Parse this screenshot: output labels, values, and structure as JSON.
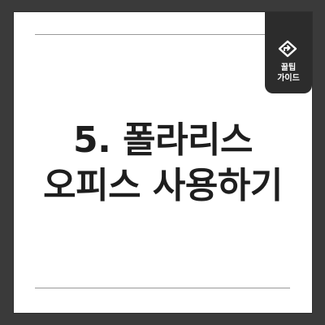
{
  "title": {
    "line1": "5. 폴라리스",
    "line2": "오피스 사용하기"
  },
  "badge": {
    "icon": "diamond-arrow-icon",
    "line1": "꿀팁",
    "line2": "가이드"
  },
  "colors": {
    "background": "#3a3a3a",
    "card": "#ffffff",
    "badge": "#2c2c2c",
    "text": "#1e1e1e",
    "rule": "#9a9a9a"
  }
}
